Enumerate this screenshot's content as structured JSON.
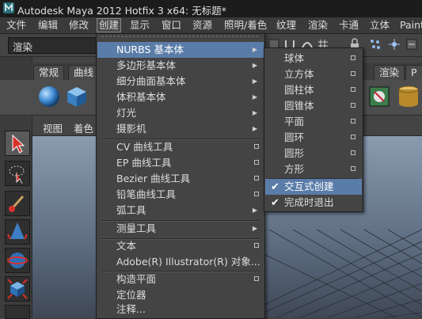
{
  "window": {
    "title": "Autodesk Maya 2012 Hotfix 3 x64: 无标题*"
  },
  "menubar": {
    "items": [
      {
        "label": "文件"
      },
      {
        "label": "编辑"
      },
      {
        "label": "修改"
      },
      {
        "label": "创建"
      },
      {
        "label": "显示"
      },
      {
        "label": "窗口"
      },
      {
        "label": "资源"
      },
      {
        "label": "照明/着色"
      },
      {
        "label": "纹理"
      },
      {
        "label": "渲染"
      },
      {
        "label": "卡通"
      },
      {
        "label": "立体"
      },
      {
        "label": "Paint"
      }
    ]
  },
  "statusline": {
    "mode_value": "渲染"
  },
  "shelf": {
    "tabs": [
      {
        "label": "常规"
      },
      {
        "label": "曲线"
      },
      {
        "label": "渲染"
      },
      {
        "label": "P"
      }
    ]
  },
  "panel": {
    "menus": [
      {
        "label": "视图"
      },
      {
        "label": "着色"
      }
    ]
  },
  "create_menu": {
    "items": [
      {
        "label": "NURBS 基本体"
      },
      {
        "label": "多边形基本体"
      },
      {
        "label": "细分曲面基本体"
      },
      {
        "label": "体积基本体"
      },
      {
        "label": "灯光"
      },
      {
        "label": "摄影机"
      },
      {
        "label": "CV 曲线工具"
      },
      {
        "label": "EP 曲线工具"
      },
      {
        "label": "Bezier 曲线工具"
      },
      {
        "label": "铅笔曲线工具"
      },
      {
        "label": "弧工具"
      },
      {
        "label": "测量工具"
      },
      {
        "label": "文本"
      },
      {
        "label": "Adobe(R) Illustrator(R) 对象..."
      },
      {
        "label": "构造平面"
      },
      {
        "label": "定位器"
      },
      {
        "label": "注释..."
      }
    ]
  },
  "nurbs_submenu": {
    "items": [
      {
        "label": "球体"
      },
      {
        "label": "立方体"
      },
      {
        "label": "圆柱体"
      },
      {
        "label": "圆锥体"
      },
      {
        "label": "平面"
      },
      {
        "label": "圆环"
      },
      {
        "label": "圆形"
      },
      {
        "label": "方形"
      },
      {
        "label": "交互式创建",
        "checked": true
      },
      {
        "label": "完成时退出",
        "checked": true
      }
    ]
  },
  "colors": {
    "highlight": "#5a7ca8",
    "menu_bg": "#444444",
    "titlebar": "#1c1c1c"
  }
}
